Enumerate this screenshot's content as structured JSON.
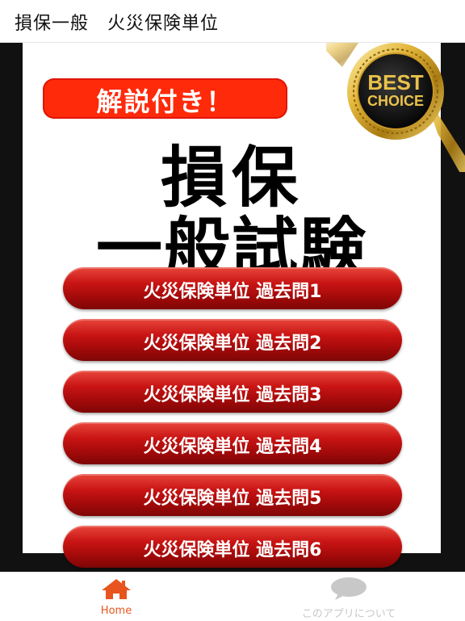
{
  "app": {
    "title": "損保一般　火災保険単位"
  },
  "banner": {
    "ribbon_text": "解説付き！",
    "headline_line1": "損保",
    "headline_line2": "一般試験",
    "badge_line1": "BEST",
    "badge_line2": "CHOICE"
  },
  "menu": {
    "buttons": [
      {
        "label": "火災保険単位 過去問1"
      },
      {
        "label": "火災保険単位 過去問2"
      },
      {
        "label": "火災保険単位 過去問3"
      },
      {
        "label": "火災保険単位 過去問4"
      },
      {
        "label": "火災保険単位 過去問5"
      },
      {
        "label": "火災保険単位 過去問6"
      }
    ]
  },
  "tabs": [
    {
      "label": "Home",
      "icon": "home-icon",
      "active": true,
      "color": "#e8541e"
    },
    {
      "label": "このアプリについて",
      "icon": "speech-bubble-icon",
      "active": false,
      "color": "#c8c8c8"
    }
  ],
  "colors": {
    "accent": "#e8541e",
    "button_red": "#c91414",
    "ribbon_red": "#ff2a0a",
    "background_dark": "#111111"
  }
}
